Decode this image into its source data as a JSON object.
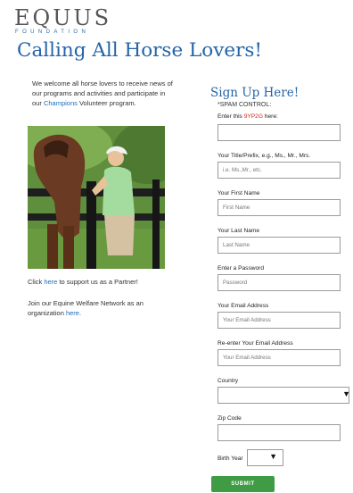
{
  "logo": {
    "main": "EQUUS",
    "sub": "FOUNDATION"
  },
  "page_title": "Calling All Horse Lovers!",
  "intro": {
    "before": "We welcome all horse lovers to receive news of our programs and activities and participate in our ",
    "link": "Champions",
    "after": " Volunteer program."
  },
  "photo": {
    "icon": "horse-and-woman-photo"
  },
  "partner": {
    "before": "Click ",
    "link": "here",
    "after": " to support us as a Partner!"
  },
  "network": {
    "before": "Join our Equine Welfare Network as an organization ",
    "link": "here",
    "after": "."
  },
  "form": {
    "heading": "Sign Up Here!",
    "spam_label": "*SPAM CONTROL:",
    "captcha_before": "Enter this ",
    "captcha_code": "9YP2G",
    "captcha_after": " here:",
    "captcha_value": "",
    "title_label": "Your Title/Prefix, e.g., Ms., Mr., Mrs.",
    "title_placeholder": "i.e. Ms.,Mr., etc.",
    "first_label": "Your First Name",
    "first_placeholder": "First Name",
    "last_label": "Your Last Name",
    "last_placeholder": "Last Name",
    "password_label": "Enter a Password",
    "password_placeholder": "Password",
    "email_label": "Your Email Address",
    "email_placeholder": "Your Email Address",
    "email2_label": "Re-enter Your Email Address",
    "email2_placeholder": "Your Email Address",
    "country_label": "Country",
    "country_value": "",
    "zip_label": "Zip Code",
    "zip_value": "",
    "birth_label": "Birth Year",
    "birth_value": "",
    "submit_label": "SUBMIT"
  },
  "colors": {
    "brand_blue": "#2464a8",
    "link_blue": "#1a6dbf",
    "captcha_red": "#d6281f",
    "submit_green": "#3f9c45"
  }
}
